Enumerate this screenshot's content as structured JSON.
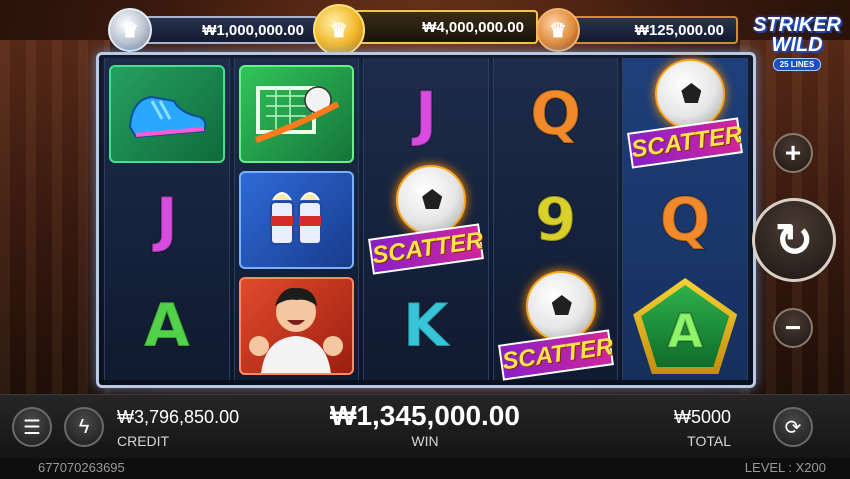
{
  "jackpots": {
    "silver": "₩1,000,000.00",
    "gold": "₩4,000,000.00",
    "bronze": "₩125,000.00"
  },
  "logo": {
    "line1": "STRIKER",
    "line2": "WILD",
    "lines": "25 LINES"
  },
  "reels": [
    [
      "boot-symbol",
      "J",
      "A"
    ],
    [
      "goal-symbol",
      "drink-symbol",
      "player-symbol"
    ],
    [
      "J",
      "SCATTER",
      "K"
    ],
    [
      "Q",
      "9",
      "SCATTER"
    ],
    [
      "SCATTER",
      "Q",
      "A"
    ]
  ],
  "symbols": {
    "j": "J",
    "q": "Q",
    "k": "K",
    "a": "A",
    "nine": "9",
    "scatter": "SCATTER"
  },
  "bottom": {
    "credit_value": "₩3,796,850.00",
    "credit_label": "CREDIT",
    "win_value": "₩1,345,000.00",
    "win_label": "WIN",
    "total_value": "₩5000",
    "total_label": "TOTAL"
  },
  "footer": {
    "session_id": "677070263695",
    "level_label": "LEVEL : ",
    "level_value": "X200"
  },
  "controls": {
    "plus": "+",
    "minus": "−",
    "spin": "↻",
    "menu": "☰",
    "turbo": "ϟ",
    "autoplay": "⟳"
  }
}
